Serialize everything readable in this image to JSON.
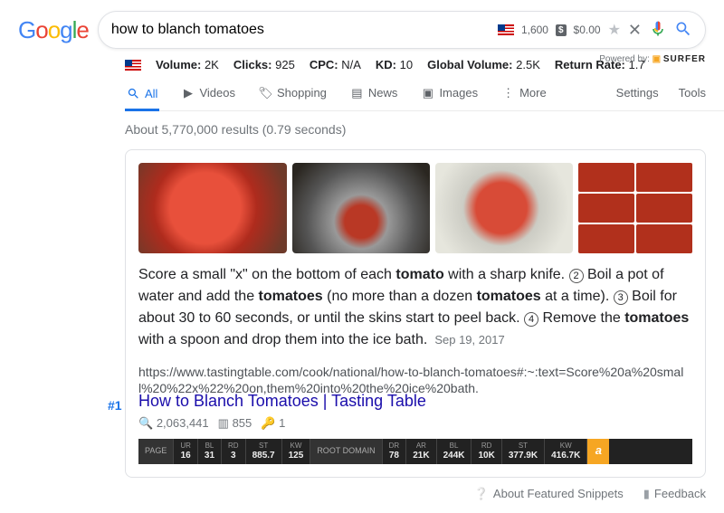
{
  "search": {
    "query": "how to blanch tomatoes",
    "volume": "1,600",
    "cost": "$0.00"
  },
  "metrics": {
    "volume_label": "Volume:",
    "volume": "2K",
    "clicks_label": "Clicks:",
    "clicks": "925",
    "cpc_label": "CPC:",
    "cpc": "N/A",
    "kd_label": "KD:",
    "kd": "10",
    "gv_label": "Global Volume:",
    "gv": "2.5K",
    "rr_label": "Return Rate:",
    "rr": "1.7",
    "powered_label": "Powered by:",
    "powered_brand": "SURFER"
  },
  "tabs": {
    "all": "All",
    "videos": "Videos",
    "shopping": "Shopping",
    "news": "News",
    "images": "Images",
    "more": "More",
    "settings": "Settings",
    "tools": "Tools"
  },
  "stats": "About 5,770,000 results (0.79 seconds)",
  "snippet": {
    "p1a": "Score a small \"x\" on the bottom of each ",
    "b1": "tomato",
    "p1b": " with a sharp knife. ",
    "n2": "2",
    "p2a": " Boil a pot of water and add the ",
    "b2": "tomatoes",
    "p2b": " (no more than a dozen ",
    "b3": "tomatoes",
    "p2c": " at a time). ",
    "n3": "3",
    "p3a": " Boil for about 30 to 60 seconds, or until the skins start to peel back. ",
    "n4": "4",
    "p4a": " Remove the ",
    "b4": "tomatoes",
    "p4b": " with a spoon and drop them into the ice bath.",
    "date": "Sep 19, 2017"
  },
  "result": {
    "rank": "#1",
    "url": "https://www.tastingtable.com/cook/national/how-to-blanch-tomatoes#:~:text=Score%20a%20small%20%22x%22%20on,them%20into%20the%20ice%20bath.",
    "title": "How to Blanch Tomatoes | Tasting Table",
    "traffic": "2,063,441",
    "words": "855",
    "kw": "1"
  },
  "ahrefs": {
    "page_label": "PAGE",
    "cells": [
      {
        "lbl": "UR",
        "val": "16"
      },
      {
        "lbl": "BL",
        "val": "31"
      },
      {
        "lbl": "RD",
        "val": "3"
      },
      {
        "lbl": "ST",
        "val": "885.7"
      },
      {
        "lbl": "KW",
        "val": "125"
      }
    ],
    "root_label": "ROOT DOMAIN",
    "cells2": [
      {
        "lbl": "DR",
        "val": "78"
      },
      {
        "lbl": "AR",
        "val": "21K"
      },
      {
        "lbl": "BL",
        "val": "244K"
      },
      {
        "lbl": "RD",
        "val": "10K"
      },
      {
        "lbl": "ST",
        "val": "377.9K"
      },
      {
        "lbl": "KW",
        "val": "416.7K"
      }
    ]
  },
  "footer": {
    "about": "About Featured Snippets",
    "feedback": "Feedback"
  }
}
